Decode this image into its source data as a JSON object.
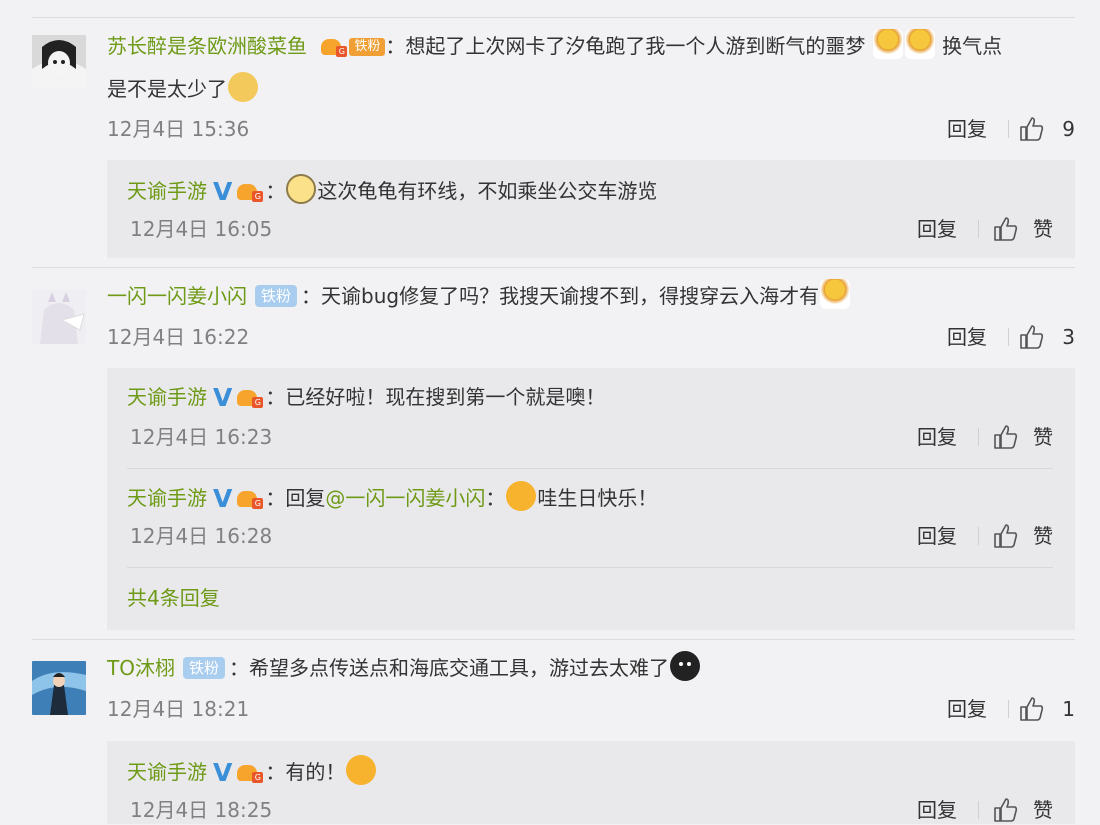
{
  "comments": [
    {
      "username": "苏长醉是条欧洲酸菜鱼",
      "badge": "铁粉",
      "text_line1": "想起了上次网卡了汐龟跑了我一个人游到断气的噩梦",
      "text_after_emoji": "换气点",
      "text_line2": "是不是太少了",
      "time": "12月4日 15:36",
      "reply_label": "回复",
      "likes": "9"
    },
    {
      "username": "一闪一闪姜小闪",
      "badge": "铁粉",
      "text": "天谕bug修复了吗？我搜天谕搜不到，得搜穿云入海才有",
      "time": "12月4日 16:22",
      "reply_label": "回复",
      "likes": "3"
    },
    {
      "username": "TO沐栩",
      "badge": "铁粉",
      "text": "希望多点传送点和海底交通工具，游过去太难了",
      "time": "12月4日 18:21",
      "reply_label": "回复",
      "likes": "1"
    }
  ],
  "replies": [
    {
      "username": "天谕手游",
      "verified": "V",
      "text": "这次龟龟有环线，不如乘坐公交车游览",
      "time": "12月4日 16:05",
      "reply_label": "回复",
      "like_label": "赞"
    },
    {
      "username": "天谕手游",
      "verified": "V",
      "text": "已经好啦！现在搜到第一个就是噢！",
      "time": "12月4日 16:23",
      "reply_label": "回复",
      "like_label": "赞"
    },
    {
      "username": "天谕手游",
      "verified": "V",
      "prefix": "回复",
      "mention": "@一闪一闪姜小闪",
      "text": "哇生日快乐！",
      "time": "12月4日 16:28",
      "reply_label": "回复",
      "like_label": "赞"
    },
    {
      "username": "天谕手游",
      "verified": "V",
      "text": "有的！",
      "time": "12月4日 18:25",
      "reply_label": "回复",
      "like_label": "赞"
    }
  ],
  "more_replies": "共4条回复",
  "colon": "：",
  "crown_mark": "G",
  "colors": {
    "username": "#6e9a16",
    "verified": "#3b8fd9",
    "background": "#f2f2f5",
    "reply_box": "#e9e9ec"
  },
  "icons": [
    "like-icon",
    "crown-icon",
    "verified-icon",
    "emoji-icon"
  ]
}
